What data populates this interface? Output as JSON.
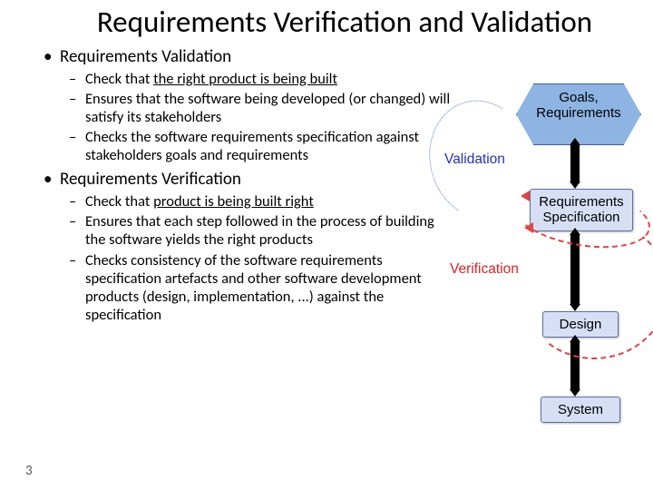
{
  "title": "Requirements Verification and Validation",
  "page_number": "3",
  "sections": [
    {
      "heading": "Requirements Validation",
      "items": [
        {
          "prefix": "Check that ",
          "emph": "the right product is being built",
          "suffix": ""
        },
        {
          "prefix": "",
          "emph": "",
          "suffix": "Ensures that the software being developed (or changed) will satisfy its stakeholders"
        },
        {
          "prefix": "",
          "emph": "",
          "suffix": "Checks the software requirements specification against stakeholders goals and requirements"
        }
      ]
    },
    {
      "heading": "Requirements Verification",
      "items": [
        {
          "prefix": "Check that ",
          "emph": "product is being built right",
          "suffix": ""
        },
        {
          "prefix": "",
          "emph": "",
          "suffix": "Ensures that each step followed in the process of building the software yields the right products"
        },
        {
          "prefix": "",
          "emph": "",
          "suffix": "Checks consistency of the software requirements specification artefacts and other software development products (design, implementation, ...) against the specification"
        }
      ]
    }
  ],
  "diagram": {
    "goals_line1": "Goals,",
    "goals_line2": "Requirements",
    "req_spec_line1": "Requirements",
    "req_spec_line2": "Specification",
    "design": "Design",
    "system": "System",
    "label_validation": "Validation",
    "label_verification": "Verification"
  }
}
